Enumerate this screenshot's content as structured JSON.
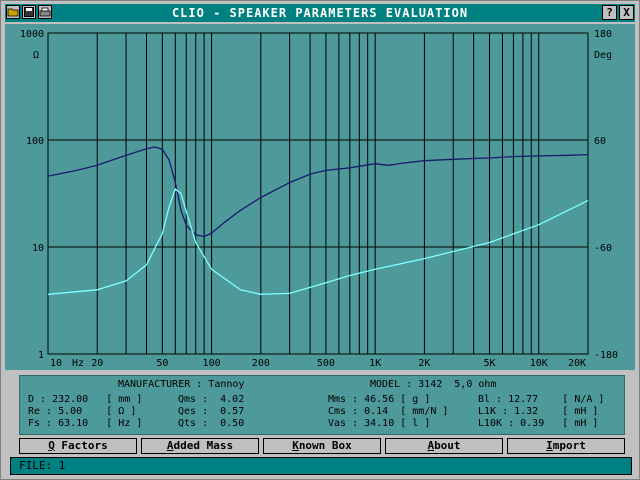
{
  "window": {
    "title": "CLIO - SPEAKER PARAMETERS EVALUATION",
    "help_label": "?",
    "close_label": "X"
  },
  "colors": {
    "window_bg": "#c0c0c0",
    "titlebar": "#008080",
    "plot_bg": "#4e9a9a",
    "impedance_color": "#1a1a6e",
    "phase_color": "#7fffff",
    "grid_color": "#000000"
  },
  "chart_data": {
    "type": "line",
    "title": "",
    "x_scale": "log",
    "xlim": [
      10,
      20000
    ],
    "left_axis": {
      "unit_label": "Ω",
      "scale": "log",
      "range": [
        1,
        1000
      ],
      "ticks": [
        "1000",
        "100",
        "10",
        "1"
      ]
    },
    "right_axis": {
      "unit_label": "Deg",
      "scale": "linear",
      "range": [
        -180,
        180
      ],
      "ticks": [
        "180",
        "60",
        "-60",
        "-180"
      ]
    },
    "x_ticks": [
      "10",
      "Hz",
      "20",
      "50",
      "100",
      "200",
      "500",
      "1K",
      "2K",
      "5K",
      "10K",
      "20K"
    ],
    "grid": true,
    "series": [
      {
        "axis": "left",
        "color": "#1a1a6e",
        "x": [
          10,
          15,
          20,
          30,
          40,
          45,
          50,
          55,
          60,
          65,
          70,
          80,
          90,
          100,
          120,
          150,
          200,
          300,
          400,
          500,
          700,
          1000,
          1200,
          1500,
          2000,
          3000,
          5000,
          7000,
          10000,
          15000,
          20000
        ],
        "y": [
          46,
          52,
          58,
          72,
          83,
          86,
          82,
          65,
          40,
          22,
          16,
          13,
          12.5,
          13.5,
          17,
          22,
          29,
          40,
          48,
          52,
          55,
          60,
          58,
          61,
          64,
          66,
          68,
          70,
          71,
          72,
          73
        ]
      },
      {
        "axis": "right",
        "color": "#7fffff",
        "x": [
          10,
          20,
          30,
          40,
          50,
          55,
          60,
          65,
          70,
          80,
          100,
          150,
          200,
          300,
          500,
          700,
          1000,
          2000,
          5000,
          10000,
          20000
        ],
        "y": [
          -113,
          -108,
          -98,
          -80,
          -45,
          -15,
          5,
          0,
          -20,
          -55,
          -85,
          -108,
          -113,
          -112,
          -100,
          -92,
          -85,
          -73,
          -55,
          -35,
          -8
        ]
      }
    ]
  },
  "info": {
    "manufacturer": "MANUFACTURER : Tannoy",
    "model": "MODEL : 3142  5,0 ohm",
    "col1": [
      "D : 232.00   [ mm ]",
      "Re : 5.00    [ Ω ]",
      "Fs : 63.10   [ Hz ]"
    ],
    "col2": [
      "Qms :  4.02",
      "Qes :  0.57",
      "Qts :  0.50"
    ],
    "col3": [
      "Mms : 46.56 [ g ]",
      "Cms : 0.14  [ mm/N ]",
      "Vas : 34.10 [ l ]"
    ],
    "col4": [
      "Bl : 12.77    [ N/A ]",
      "L1K : 1.32    [ mH ]",
      "L10K : 0.39   [ mH ]"
    ]
  },
  "buttons": [
    {
      "first": "Q",
      "rest": " Factors"
    },
    {
      "first": "A",
      "rest": "dded Mass"
    },
    {
      "first": "K",
      "rest": "nown Box"
    },
    {
      "first": "A",
      "rest": "bout"
    },
    {
      "first": "I",
      "rest": "mport"
    }
  ],
  "status": {
    "text": "FILE: 1"
  }
}
